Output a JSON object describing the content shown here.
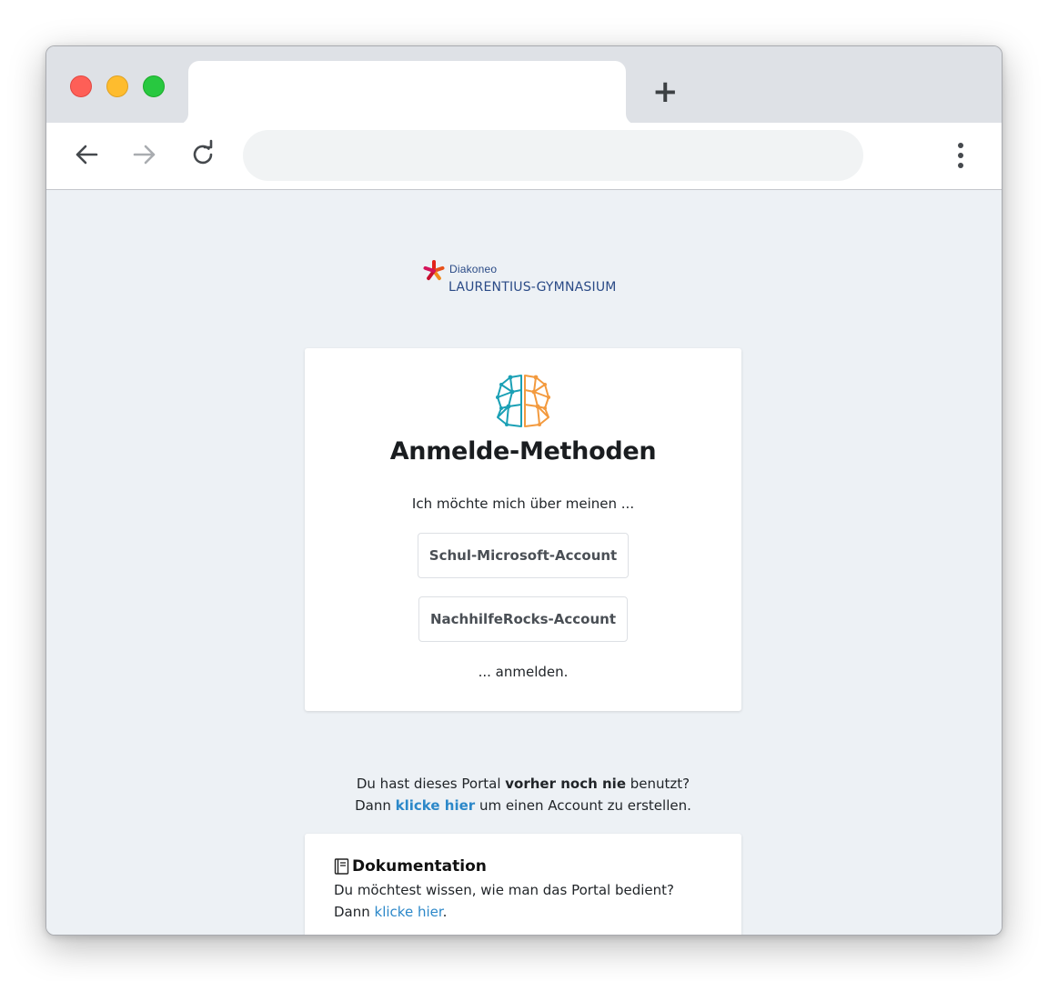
{
  "browser": {
    "tab_title": "",
    "new_tab_label": "+",
    "address": ""
  },
  "icons": {
    "back": "arrow-left-icon",
    "forward": "arrow-right-icon",
    "reload": "reload-icon",
    "menu": "kebab-menu-icon",
    "documentation": "book-icon",
    "logo_mark": "diakoneo-star-icon",
    "brain": "brain-network-icon"
  },
  "colors": {
    "link": "#2c88c9",
    "logo_blue": "#2a4a86",
    "brain_teal": "#1aa0b5",
    "brain_orange": "#f39a3e",
    "star_red": "#e2231a",
    "page_bg": "#edf1f5"
  },
  "logo": {
    "small_text": "Diakoneo",
    "school_name": "LAURENTIUS-GYMNASIUM"
  },
  "login_card": {
    "title": "Anmelde-Methoden",
    "intro": "Ich möchte mich über meinen ...",
    "ms_button": "Schul-Microsoft-Account",
    "nr_button": "NachhilfeRocks-Account",
    "outro": "... anmelden."
  },
  "signup": {
    "line1_prefix": "Du hast dieses Portal ",
    "line1_bold": "vorher noch nie",
    "line1_suffix": " benutzt?",
    "line2_prefix": "Dann ",
    "line2_link": "klicke hier",
    "line2_suffix": " um einen Account zu erstellen."
  },
  "documentation": {
    "title": "Dokumentation",
    "line1": "Du möchtest wissen, wie man das Portal bedient?",
    "line2_prefix": "Dann ",
    "line2_link": "klicke hier",
    "line2_suffix": "."
  }
}
